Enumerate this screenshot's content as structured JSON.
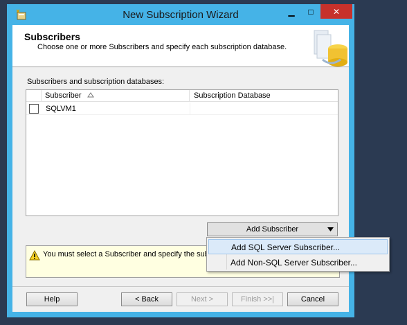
{
  "window": {
    "title": "New Subscription Wizard"
  },
  "title_controls": {
    "minimize": "▁",
    "maximize": "□",
    "close": "✕"
  },
  "header": {
    "title": "Subscribers",
    "subtitle": "Choose one or more Subscribers and specify each subscription database."
  },
  "grid": {
    "label": "Subscribers and subscription databases:",
    "columns": {
      "subscriber": "Subscriber",
      "database": "Subscription Database"
    },
    "rows": [
      {
        "subscriber": "SQLVM1",
        "database": "",
        "checked": false
      }
    ]
  },
  "add_subscriber": {
    "label": "Add Subscriber"
  },
  "menu": {
    "items": [
      {
        "label": "Add SQL Server Subscriber..."
      },
      {
        "label": "Add Non-SQL Server Subscriber..."
      }
    ]
  },
  "warning": {
    "text": "You must select a Subscriber and specify the subs wizard."
  },
  "buttons": {
    "help": "Help",
    "back": "< Back",
    "next": "Next >",
    "finish": "Finish >>|",
    "cancel": "Cancel"
  },
  "colors": {
    "title_bar": "#45b3e7",
    "close": "#c7312b",
    "desktop": "#2b3a52",
    "menu_highlight": "#dbeaf9"
  }
}
